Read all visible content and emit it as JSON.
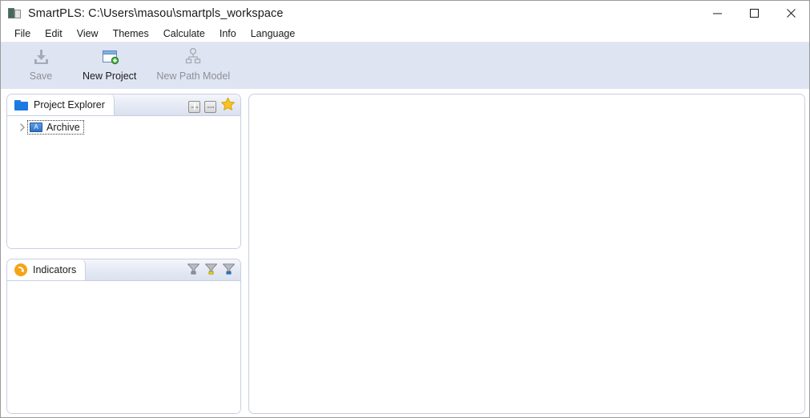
{
  "window": {
    "title": "SmartPLS: C:\\Users\\masou\\smartpls_workspace",
    "app_icon": "smartpls-app-icon",
    "controls": {
      "minimize": "minimize-icon",
      "maximize": "maximize-icon",
      "close": "close-icon"
    }
  },
  "menu": {
    "items": [
      {
        "label": "File"
      },
      {
        "label": "Edit"
      },
      {
        "label": "View"
      },
      {
        "label": "Themes"
      },
      {
        "label": "Calculate"
      },
      {
        "label": "Info"
      },
      {
        "label": "Language"
      }
    ]
  },
  "toolbar": {
    "buttons": [
      {
        "label": "Save",
        "icon": "save-icon",
        "enabled": false
      },
      {
        "label": "New Project",
        "icon": "new-project-icon",
        "enabled": true
      },
      {
        "label": "New Path Model",
        "icon": "new-path-model-icon",
        "enabled": false
      }
    ]
  },
  "project_explorer": {
    "tab_label": "Project Explorer",
    "tab_icon": "folder-icon",
    "tools": [
      {
        "name": "expand-all-button",
        "icon": "plus-icon"
      },
      {
        "name": "collapse-all-button",
        "icon": "minus-icon"
      },
      {
        "name": "favorites-button",
        "icon": "star-icon"
      }
    ],
    "tree": [
      {
        "label": "Archive",
        "icon": "archive-icon",
        "expanded": false,
        "selected": true
      }
    ]
  },
  "indicators": {
    "tab_label": "Indicators",
    "tab_icon": "indicators-arrow-icon",
    "tools": [
      {
        "name": "filter-all-button",
        "icon": "filter-icon",
        "color": "#9a9a9a"
      },
      {
        "name": "filter-yellow-button",
        "icon": "filter-icon",
        "color": "#f2e500"
      },
      {
        "name": "filter-blue-button",
        "icon": "filter-icon",
        "color": "#2a7fd4"
      }
    ],
    "rows": []
  },
  "editor": {
    "content": ""
  },
  "colors": {
    "toolbar_background": "#dfe4f2",
    "panel_border": "#c8cfe2",
    "accent_blue": "#1b7ae0",
    "accent_orange": "#f5a416",
    "star_gold": "#f7c325"
  }
}
